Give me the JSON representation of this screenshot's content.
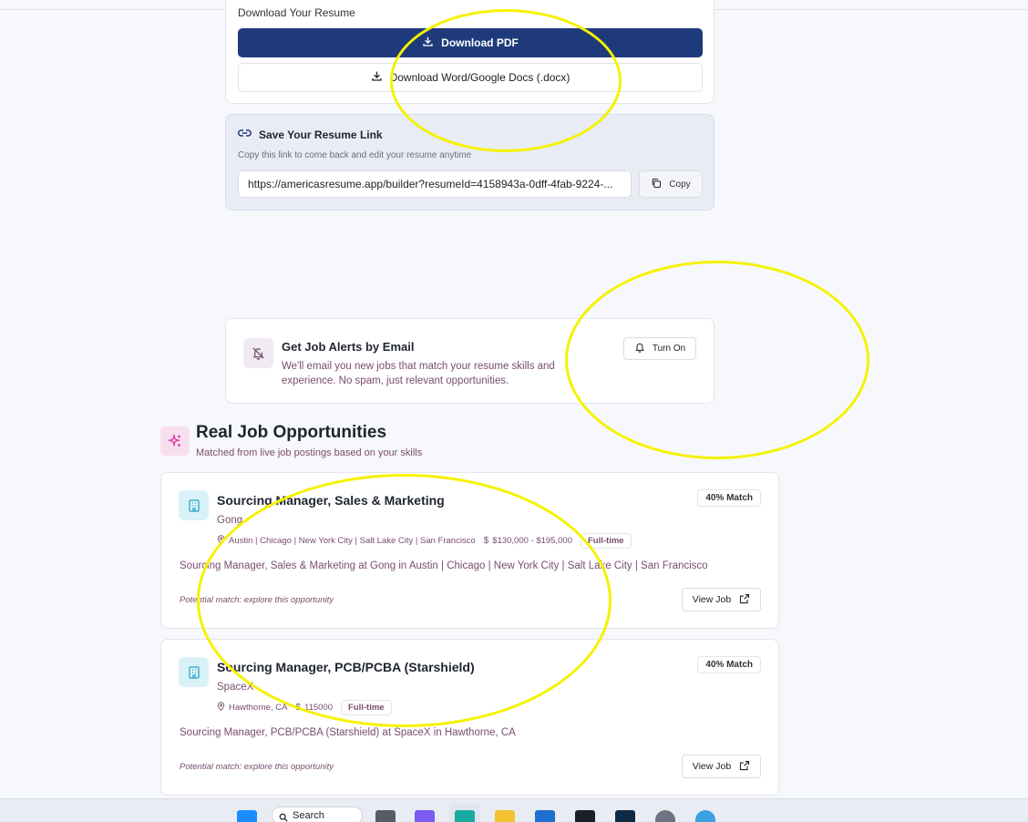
{
  "download": {
    "title": "Download Your Resume",
    "pdf_label": "Download PDF",
    "docx_label": "Download Word/Google Docs (.docx)"
  },
  "save_link": {
    "title": "Save Your Resume Link",
    "subtitle": "Copy this link to come back and edit your resume anytime",
    "url": "https://americasresume.app/builder?resumeId=4158943a-0dff-4fab-9224-...",
    "copy_label": "Copy"
  },
  "job_alerts": {
    "title": "Get Job Alerts by Email",
    "description": "We'll email you new jobs that match your resume skills and experience. No spam, just relevant opportunities.",
    "button_label": "Turn On"
  },
  "opportunities": {
    "title": "Real Job Opportunities",
    "subtitle": "Matched from live job postings based on your skills",
    "jobs": [
      {
        "title": "Sourcing Manager, Sales & Marketing",
        "company": "Gong",
        "location": "Austin | Chicago | New York City | Salt Lake City | San Francisco",
        "salary": "$130,000 - $195,000",
        "type": "Full-time",
        "match": "40% Match",
        "description": "Sourcing Manager, Sales & Marketing at Gong in Austin | Chicago | New York City | Salt Lake City | San Francisco",
        "note": "Potential match: explore this opportunity",
        "view_label": "View Job"
      },
      {
        "title": "Sourcing Manager, PCB/PCBA (Starshield)",
        "company": "SpaceX",
        "location": "Hawthorne, CA",
        "salary": "115000",
        "type": "Full-time",
        "match": "40% Match",
        "description": "Sourcing Manager, PCB/PCBA (Starshield) at SpaceX in Hawthorne, CA",
        "note": "Potential match: explore this opportunity",
        "view_label": "View Job"
      }
    ]
  },
  "taskbar": {
    "search_label": "Search"
  },
  "colors": {
    "primary": "#1e3a7a",
    "muted_text": "#7a4d6e",
    "annotation": "#f5f200"
  }
}
